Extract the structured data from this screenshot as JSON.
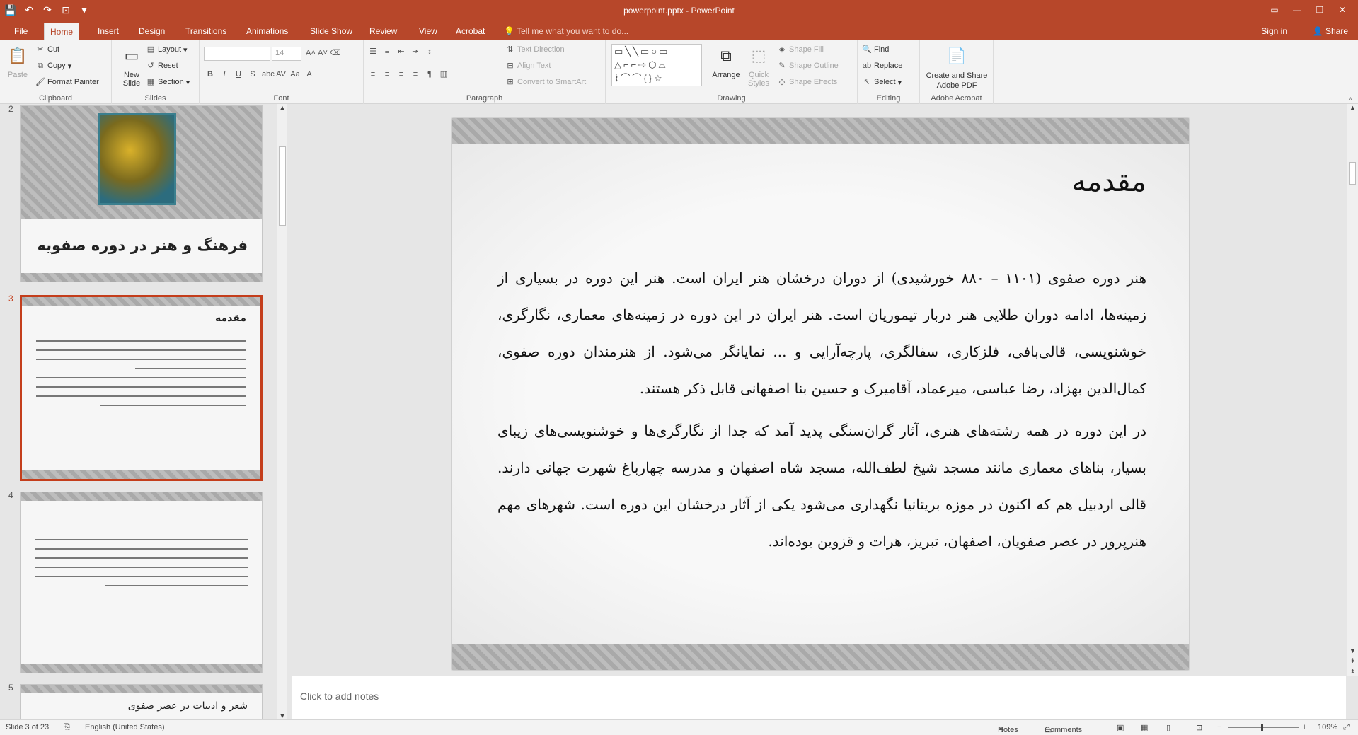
{
  "window": {
    "title": "powerpoint.pptx - PowerPoint"
  },
  "qat": {
    "save": "💾",
    "undo": "↶",
    "redo": "↷",
    "present": "⊡",
    "more": "▾"
  },
  "tabs": [
    "File",
    "Home",
    "Insert",
    "Design",
    "Transitions",
    "Animations",
    "Slide Show",
    "Review",
    "View",
    "Acrobat"
  ],
  "active_tab": "Home",
  "tell_me": "Tell me what you want to do...",
  "sign_in": "Sign in",
  "share": "Share",
  "ribbon": {
    "clipboard": {
      "label": "Clipboard",
      "paste": "Paste",
      "cut": "Cut",
      "copy": "Copy",
      "format_painter": "Format Painter"
    },
    "slides": {
      "label": "Slides",
      "new_slide": "New Slide",
      "layout": "Layout",
      "reset": "Reset",
      "section": "Section"
    },
    "font": {
      "label": "Font",
      "font_name": "",
      "font_size": "14"
    },
    "paragraph": {
      "label": "Paragraph",
      "text_direction": "Text Direction",
      "align_text": "Align Text",
      "convert": "Convert to SmartArt"
    },
    "drawing": {
      "label": "Drawing",
      "arrange": "Arrange",
      "quick_styles": "Quick Styles",
      "shape_fill": "Shape Fill",
      "shape_outline": "Shape Outline",
      "shape_effects": "Shape Effects"
    },
    "editing": {
      "label": "Editing",
      "find": "Find",
      "replace": "Replace",
      "select": "Select"
    },
    "acrobat": {
      "label": "Adobe Acrobat",
      "create_share": "Create and Share Adobe PDF"
    }
  },
  "thumbnails": [
    {
      "num": "2",
      "title": "فرهنگ و هنر در دوره صفویه"
    },
    {
      "num": "3",
      "title": "مقدمه"
    },
    {
      "num": "4",
      "title": ""
    },
    {
      "num": "5",
      "title": "شعر و ادبیات در عصر صفوی"
    }
  ],
  "slide": {
    "title": "مقدمه",
    "paragraphs": [
      "هنر دوره صفوی (۱۱۰۱ – ۸۸۰ خورشیدی) از دوران درخشان هنر ایران است. هنر این دوره در بسیاری از زمینه‌ها، ادامه دوران طلایی هنر دربار تیموریان است. هنر ایران در این دوره در زمینه‌های معماری، نگارگری، خوشنویسی، قالی‌بافی، فلزکاری، سفالگری، پارچه‌آرایی و ... نمایانگر می‌شود. از هنرمندان دوره صفوی، کمال‌الدین بهزاد، رضا عباسی، میرعماد، آقامیرک و حسین بنا اصفهانی قابل ذکر هستند.",
      "در این دوره در همه رشته‌های هنری، آثار گران‌سنگی پدید آمد که جدا از نگارگری‌ها و خوشنویسی‌های زیبای بسیار، بناهای معماری مانند مسجد شیخ لطف‌الله، مسجد شاه اصفهان و مدرسه چهارباغ شهرت جهانی دارند. قالی اردبیل هم که اکنون در موزه بریتانیا نگهداری می‌شود یکی از آثار درخشان این دوره است. شهرهای مهم هنرپرور در عصر صفویان، اصفهان، تبریز، هرات و قزوین بوده‌اند."
    ]
  },
  "notes_placeholder": "Click to add notes",
  "status": {
    "slide_info": "Slide 3 of 23",
    "language": "English (United States)",
    "notes": "Notes",
    "comments": "Comments",
    "zoom": "109%"
  },
  "colors": {
    "accent": "#b7472a",
    "selected_border": "#c43e1c"
  }
}
